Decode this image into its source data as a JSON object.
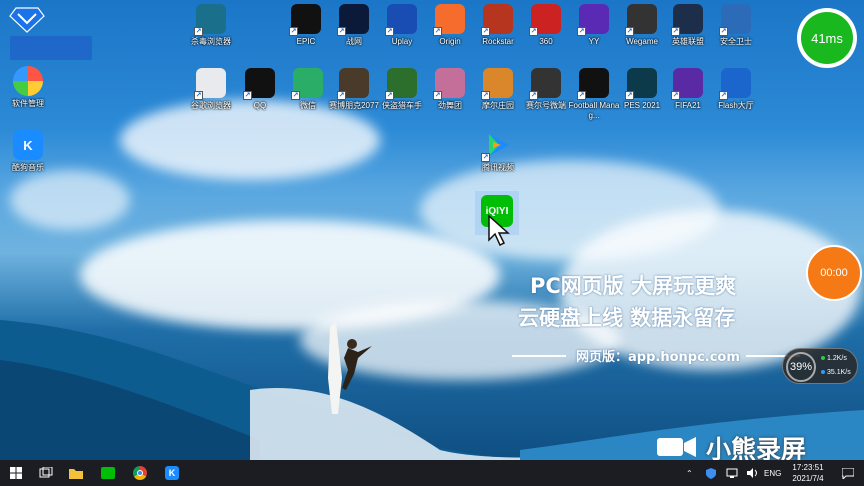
{
  "desktop": {
    "left_icons": [
      {
        "label": "腾讯电脑管家",
        "color": "#1a73e8"
      },
      {
        "label": "软件管理",
        "color": "#ff6b35"
      },
      {
        "label": "酷狗音乐",
        "color": "#1a8cff"
      }
    ],
    "row1_icons": [
      {
        "label": "杀毒浏览器",
        "color": "#1a6f8a"
      },
      {
        "label": "EPIC",
        "color": "#111"
      },
      {
        "label": "战网",
        "color": "#0c1a3a"
      },
      {
        "label": "Uplay",
        "color": "#1a4db3"
      },
      {
        "label": "Origin",
        "color": "#f56c2d"
      },
      {
        "label": "Rockstar",
        "color": "#b5351f"
      },
      {
        "label": "360",
        "color": "#c22"
      },
      {
        "label": "YY",
        "color": "#5a2ab5"
      },
      {
        "label": "Wegame",
        "color": "#333"
      },
      {
        "label": "英雄联盟",
        "color": "#1c2e4a"
      },
      {
        "label": "安全卫士",
        "color": "#2b6bb8"
      }
    ],
    "row2_icons": [
      {
        "label": "谷歌浏览器",
        "color": "#e8eaed"
      },
      {
        "label": "QQ",
        "color": "#111"
      },
      {
        "label": "微信",
        "color": "#2aae67"
      },
      {
        "label": "赛博朋克2077",
        "color": "#4a3a2a"
      },
      {
        "label": "侠盗猎车手",
        "color": "#2c6e2c"
      },
      {
        "label": "劲舞团",
        "color": "#c46f9a"
      },
      {
        "label": "摩尔庄园",
        "color": "#d9872a"
      },
      {
        "label": "赛尔号微端",
        "color": "#333"
      },
      {
        "label": "Football Manag...",
        "color": "#111"
      },
      {
        "label": "PES 2021",
        "color": "#0d3a4a"
      },
      {
        "label": "FIFA21",
        "color": "#5a2aa5"
      },
      {
        "label": "Flash大厅",
        "color": "#1a66cc"
      }
    ],
    "extra_icons": [
      {
        "label": "腾讯视频",
        "color": "#1a8cff"
      },
      {
        "label": "爱奇艺",
        "color": "#00be06",
        "text": "iQIYI"
      }
    ]
  },
  "promo": {
    "line1": "PC网页版 大屏玩更爽",
    "line2": "云硬盘上线 数据永留存",
    "line3": "网页版：app.honpc.com"
  },
  "widgets": {
    "ping": "41ms",
    "timer": "00:00",
    "cpu": "39%",
    "upload": "1.2K/s",
    "download": "35.1K/s"
  },
  "watermark": "小熊录屏",
  "taskbar": {
    "apps": [
      "start",
      "task-view",
      "file-explorer",
      "iqiyi",
      "chrome",
      "kugou"
    ],
    "language": "ENG",
    "time": "17:23:51",
    "date": "2021/7/4"
  },
  "colors": {
    "taskbar": "#1b1d22",
    "accent_green": "#19b81f",
    "accent_orange": "#f57a16"
  }
}
